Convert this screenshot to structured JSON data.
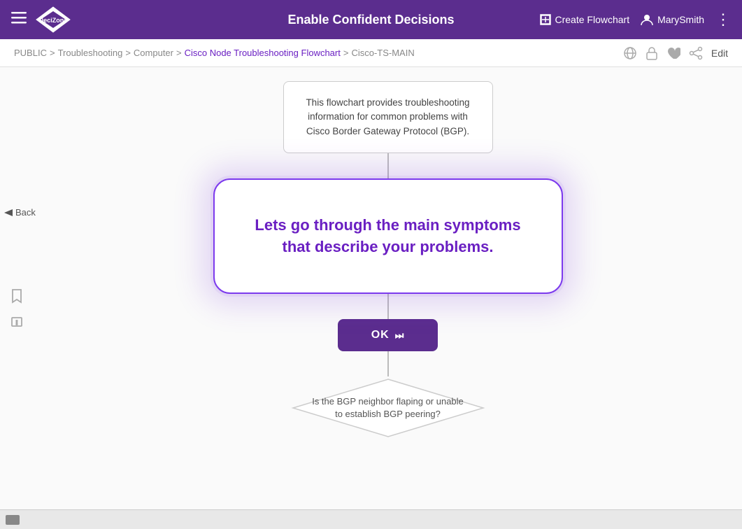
{
  "header": {
    "menu_label": "☰",
    "title": "Enable Confident Decisions",
    "create_flowchart_label": "Create Flowchart",
    "user_label": "MarySmith",
    "more_label": "⋮",
    "logo_text": "DeciZone"
  },
  "breadcrumb": {
    "public": "PUBLIC",
    "sep1": ">",
    "troubleshooting": "Troubleshooting",
    "sep2": ">",
    "computer": "Computer",
    "sep3": ">",
    "flowchart_name": "Cisco Node Troubleshooting Flowchart",
    "sep4": ">",
    "node_name": "Cisco-TS-MAIN",
    "edit_label": "Edit"
  },
  "sidebar": {
    "back_label": "Back",
    "bookmark_title": "Bookmark",
    "flag_title": "Flag"
  },
  "flowchart": {
    "info_box_text": "This flowchart provides troubleshooting information for common problems with Cisco Border Gateway Protocol (BGP).",
    "main_box_text": "Lets go through the main symptoms that describe your problems.",
    "ok_button_label": "OK",
    "diamond_text": "Is the BGP neighbor flaping or unable to establish BGP peering?"
  },
  "icons": {
    "globe": "🌐",
    "lock": "🔒",
    "heart": "♥",
    "person": "👤",
    "pencil": "✏",
    "back_arrow": "◀",
    "bookmark": "🔖",
    "flag": "⚑",
    "next_icon": "⏭"
  }
}
